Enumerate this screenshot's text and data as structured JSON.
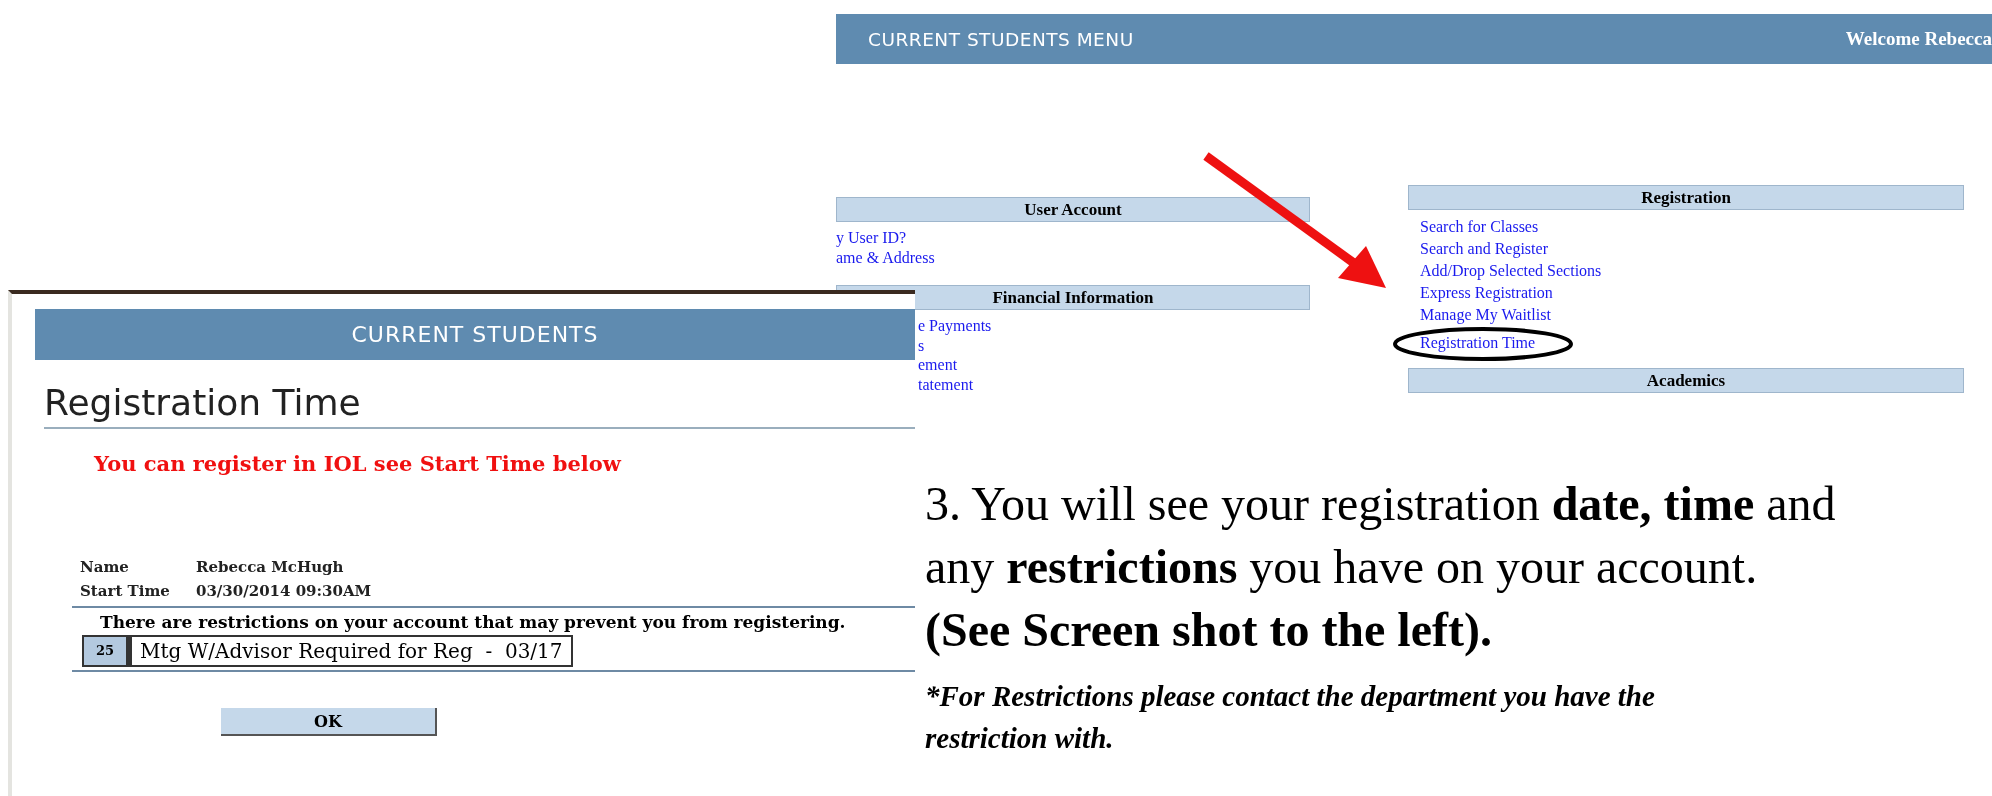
{
  "menu_screenshot": {
    "title": "CURRENT STUDENTS MENU",
    "welcome": "Welcome Rebecca",
    "left_column": [
      {
        "title": "User Account",
        "links": [
          "y User ID?",
          "ame & Address"
        ]
      },
      {
        "title": "Financial Information",
        "links": [
          "e Payments",
          "s",
          "ement",
          "tatement"
        ]
      }
    ],
    "right_column": [
      {
        "title": "Registration",
        "links": [
          "Search for Classes",
          "Search and Register",
          "Add/Drop Selected Sections",
          "Express Registration",
          "Manage My Waitlist",
          "Registration Time"
        ]
      },
      {
        "title": "Academics"
      }
    ]
  },
  "registration_screenshot": {
    "header": "CURRENT STUDENTS",
    "title": "Registration Time",
    "message": "You can register in IOL see Start Time below",
    "fields": [
      {
        "label": "Name",
        "value": "Rebecca McHugh"
      },
      {
        "label": "Start Time",
        "value": "03/30/2014 09:30AM"
      }
    ],
    "restrictions_notice": "There are restrictions on your account that may prevent you from registering.",
    "restrictions": [
      {
        "code": "25",
        "description": "Mtg W/Advisor Required for Reg  -  03/17"
      }
    ],
    "ok_button": "OK"
  },
  "instructions": {
    "paragraph": "3. You will see your registration **date, time** and any **restrictions** you have on your account.",
    "emphasis": "(See Screen shot to the left).",
    "note": "*For Restrictions please contact the department you have the restriction with."
  }
}
